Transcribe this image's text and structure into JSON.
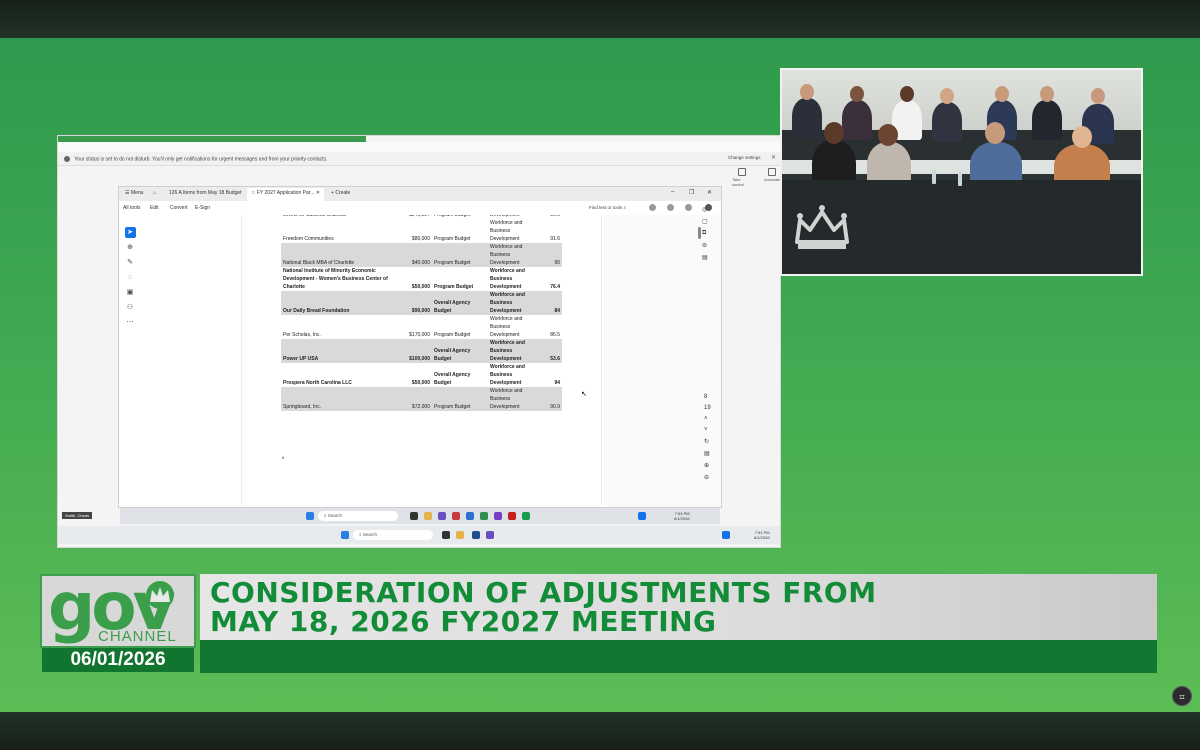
{
  "screen": {
    "notification": "Your status is set to do not disturb. You'll only get notifications for urgent messages and from your priority contacts.",
    "notification_action": "Change settings",
    "top_actions": [
      "Take control",
      "Annotate"
    ],
    "acrobat": {
      "tabs": {
        "menu": "Menu",
        "tab1": "126 A Items from May 18 Budget",
        "tab2": "FY 2027 Application Par...",
        "new_tab": "Create"
      },
      "menu": {
        "all_tools": "All tools",
        "edit": "Edit",
        "convert": "Convert",
        "esign": "E-Sign"
      },
      "find_placeholder": "Find text or tools",
      "table_rows": [
        {
          "org": "Levels for Success Charlotte",
          "amount": "$240,027",
          "source": "Program Budget",
          "category": "Development",
          "score": "90.0",
          "shade": false,
          "bold": false
        },
        {
          "org": "Freedom Communities",
          "amount": "$80,000",
          "source": "Program Budget",
          "category": "Workforce and Business Development",
          "score": "91.6",
          "shade": false,
          "bold": false
        },
        {
          "org": "National Black MBA of Charlotte",
          "amount": "$40,000",
          "source": "Program Budget",
          "category": "Workforce and Business Development",
          "score": "90",
          "shade": true,
          "bold": false
        },
        {
          "org": "National Institute of Minority Economic Development - Women's Business Center of Charlotte",
          "amount": "$50,000",
          "source": "Program Budget",
          "category": "Workforce and Business Development",
          "score": "76.4",
          "shade": false,
          "bold": true
        },
        {
          "org": "Our Daily Bread Foundation",
          "amount": "$90,000",
          "source": "Overall Agency Budget",
          "category": "Workforce and Business Development",
          "score": "84",
          "shade": true,
          "bold": true
        },
        {
          "org": "Per Scholas, Inc.",
          "amount": "$170,000",
          "source": "Program Budget",
          "category": "Workforce and Business Development",
          "score": "86.5",
          "shade": false,
          "bold": false
        },
        {
          "org": "Power UP USA",
          "amount": "$100,000",
          "source": "Overall Agency Budget",
          "category": "Workforce and Business Development",
          "score": "53.6",
          "shade": true,
          "bold": true
        },
        {
          "org": "Prospera North Carolina LLC",
          "amount": "$50,000",
          "source": "Overall Agency Budget",
          "category": "Workforce and Business Development",
          "score": "94",
          "shade": false,
          "bold": true
        },
        {
          "org": "Springboard, Inc.",
          "amount": "$72,000",
          "source": "Program Budget",
          "category": "Workforce and Business Development",
          "score": "90.9",
          "shade": true,
          "bold": false
        }
      ],
      "page_number": "8"
    },
    "taskbar_inner": {
      "search": "Search",
      "time": "7:53 PM",
      "date": "6/1/2026"
    },
    "taskbar_outer": {
      "search": "Search",
      "time": "7:53 PM",
      "date": "6/1/2026"
    },
    "speaker": "Smith, Charis"
  },
  "lower_third": {
    "logo_main": "gov",
    "logo_sub": "CHANNEL",
    "date": "06/01/2026",
    "title_line1": "CONSIDERATION OF ADJUSTMENTS FROM",
    "title_line2": "MAY 18, 2026 FY2027 MEETING"
  },
  "colors": {
    "brand_green": "#138c38",
    "dark_green": "#127831",
    "bg_green": "#45ac52",
    "acrobat_blue": "#1473e6"
  }
}
